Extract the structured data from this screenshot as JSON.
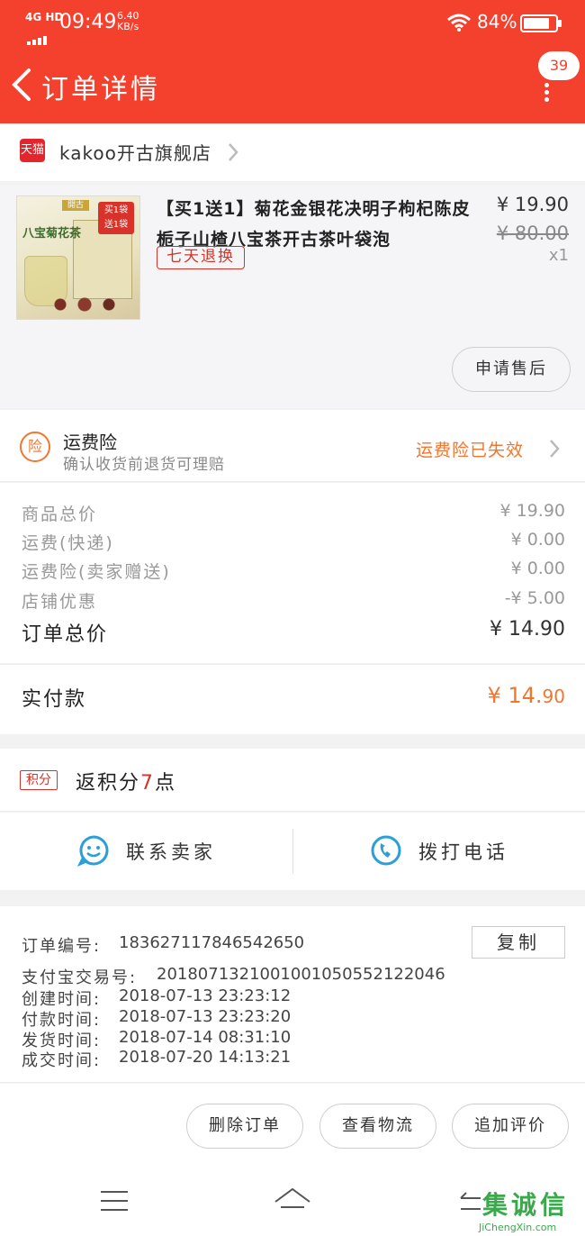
{
  "status_bar": {
    "network": "4G HD",
    "time": "09:49",
    "speed_value": "6.40",
    "speed_unit": "KB/s",
    "battery": "84%",
    "battery_level": 0.84
  },
  "header": {
    "title": "订单详情",
    "badge_count": "39"
  },
  "shop": {
    "platform_label": "天猫",
    "name": "kakoo开古旗舰店"
  },
  "product": {
    "title": "【买1送1】菊花金银花决明子枸杞陈皮栀子山楂八宝茶开古茶叶袋泡",
    "tag": "七天退换",
    "price": "¥ 19.90",
    "original_price": "¥ 80.00",
    "quantity": "x1",
    "after_sale_button": "申请售后",
    "image_text": {
      "brand": "八宝菊花茶",
      "promo_line1": "买1袋",
      "promo_line2": "送1袋",
      "logo": "開古"
    }
  },
  "insurance": {
    "icon_label": "险",
    "title": "运费险",
    "subtitle": "确认收货前退货可理赔",
    "status": "运费险已失效"
  },
  "summary": {
    "rows": [
      {
        "label": "商品总价",
        "value": "¥ 19.90"
      },
      {
        "label": "运费(快递)",
        "value": "¥ 0.00"
      },
      {
        "label": "运费险(卖家赠送)",
        "value": "¥ 0.00"
      },
      {
        "label": "店铺优惠",
        "value": "-¥ 5.00"
      }
    ],
    "total_label": "订单总价",
    "total_value": "¥ 14.90",
    "paid_label": "实付款",
    "paid_symbol": "¥ ",
    "paid_int": "14.",
    "paid_dec": "90"
  },
  "points": {
    "badge": "积分",
    "prefix": "返积分",
    "value": "7",
    "suffix": "点"
  },
  "contact": {
    "seller_label": "联系卖家",
    "phone_label": "拨打电话"
  },
  "order_info": {
    "copy_button": "复制",
    "rows": [
      {
        "label": "订单编号:",
        "value": "183627117846542650"
      },
      {
        "label": "支付宝交易号:",
        "value": "2018071321001001050552122046"
      },
      {
        "label": "创建时间:",
        "value": "2018-07-13 23:23:12"
      },
      {
        "label": "付款时间:",
        "value": "2018-07-13 23:23:20"
      },
      {
        "label": "发货时间:",
        "value": "2018-07-14 08:31:10"
      },
      {
        "label": "成交时间:",
        "value": "2018-07-20 14:13:21"
      }
    ]
  },
  "actions": {
    "delete": "删除订单",
    "logistics": "查看物流",
    "review": "追加评价"
  },
  "watermark": {
    "cn": "集诚信",
    "en": "JiChengXin.com"
  },
  "colors": {
    "header_bg": "#f4412d",
    "accent_orange": "#f2762e",
    "tag_red": "#d5342a",
    "contact_blue": "#2a9fd8"
  }
}
